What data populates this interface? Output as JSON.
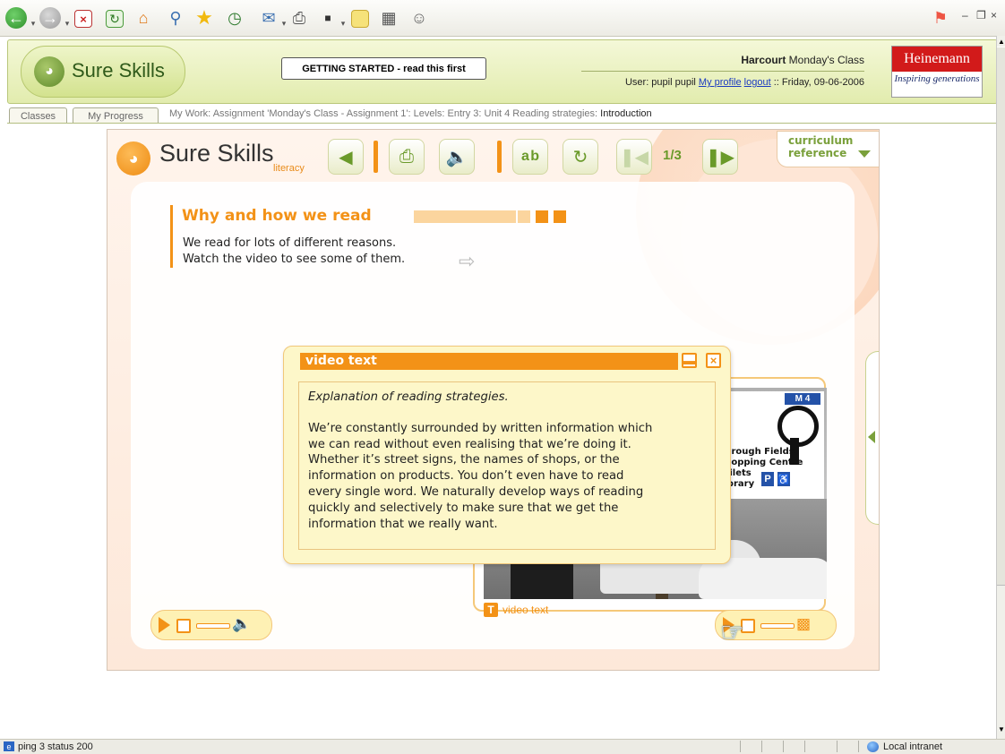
{
  "browser": {
    "status_text": "ping 3 status 200",
    "zone": "Local intranet"
  },
  "header": {
    "logo_text": "Sure Skills",
    "getting_started": "GETTING STARTED - read this first",
    "publisher_bold": "Harcourt",
    "class_name": "Monday's Class",
    "user_prefix": "User: pupil pupil",
    "my_profile": "My profile",
    "logout": "logout",
    "date_text": ":: Friday, 09-06-2006",
    "heinemann": "Heinemann",
    "tagline": "Inspiring generations"
  },
  "tabs": [
    "Classes",
    "My Progress"
  ],
  "breadcrumb": {
    "path": "My Work: Assignment 'Monday's Class - Assignment 1': Levels: Entry 3: Unit 4 Reading strategies: ",
    "current": "Introduction"
  },
  "app": {
    "logo_text": "Sure Skills",
    "logo_sub": "literacy",
    "page_counter": "1/3",
    "curriculum_line1": "curriculum",
    "curriculum_line2": "reference",
    "icons": [
      "back-icon",
      "printer-icon",
      "speaker-icon",
      "spelling-icon",
      "refresh-icon",
      "previous-icon",
      "next-icon"
    ]
  },
  "lesson": {
    "title": "Why and how we read",
    "progress": {
      "current": 3,
      "total": 3
    },
    "intro_line1": "We read for lots of different reasons.",
    "intro_line2": "Watch the video to see some of them."
  },
  "video_text": {
    "title": "video text",
    "subtitle": "Explanation of reading strategies.",
    "lines": [
      "We’re constantly surrounded by written information which",
      "we can read without even realising that we’re doing it.",
      "Whether it’s street signs, the names of shops, or the",
      "information on products. You don’t even have to read",
      "every single word. We naturally develop ways of reading",
      "quickly and selectively to make sure that we get the",
      "information that we really want."
    ]
  },
  "video": {
    "label": "video text",
    "sign_m4": "M 4",
    "sign_lines": [
      "Borough Fields",
      "Shopping Centre",
      "Toilets",
      "Library"
    ],
    "sign_p": "P"
  },
  "colors": {
    "accent_orange": "#f39217",
    "accent_green": "#7aa03b",
    "header_green": "#e2ecae"
  }
}
